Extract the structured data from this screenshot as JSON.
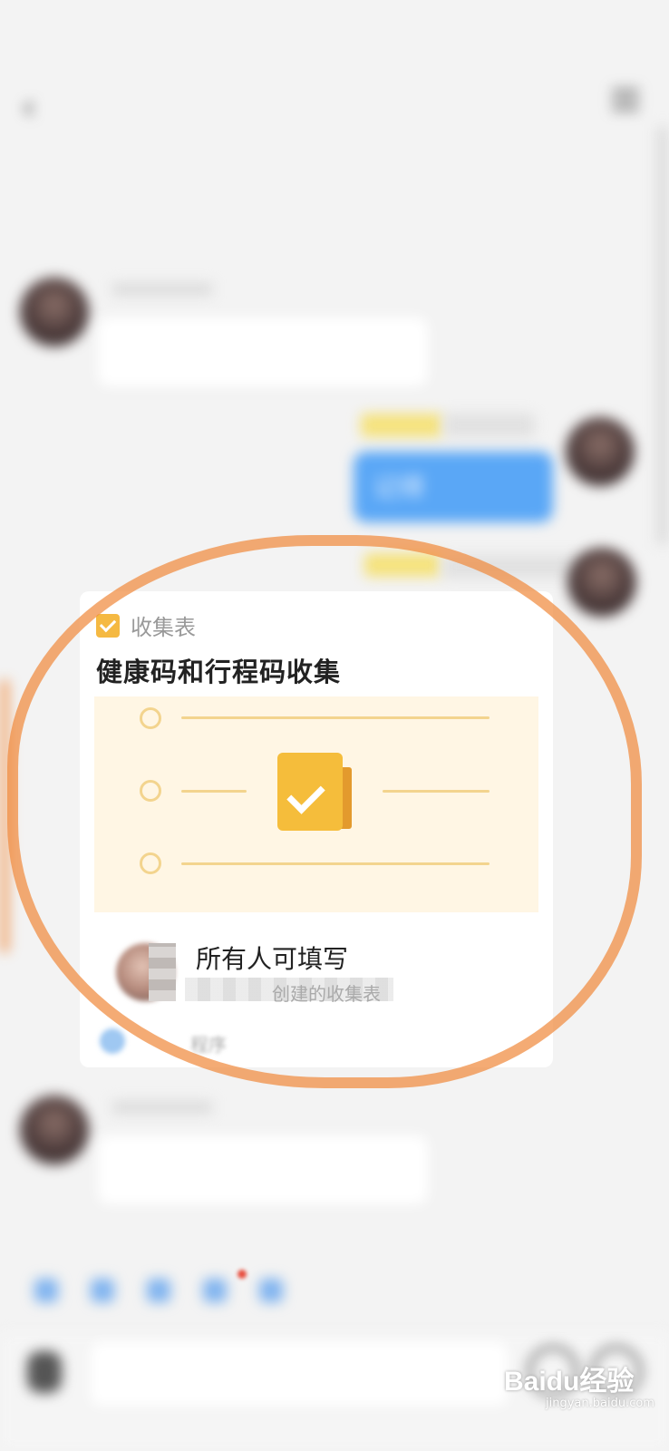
{
  "status_bar": {
    "time": "",
    "battery": ""
  },
  "header": {
    "title": "",
    "subtitle": ""
  },
  "chat": {
    "system_message": "",
    "timestamp": "",
    "messages": [
      {
        "side": "left",
        "text": ""
      },
      {
        "side": "right",
        "text": "记得"
      },
      {
        "side": "left",
        "text": ""
      }
    ]
  },
  "card": {
    "type_label": "收集表",
    "title": "健康码和行程码收集",
    "permission": "所有人可填写",
    "creator_text": "创建的收集表",
    "source": "程序"
  },
  "quick_bar": [
    {
      "label": "",
      "icon": "quick-icon-1"
    },
    {
      "label": "",
      "icon": "quick-icon-2"
    },
    {
      "label": "",
      "icon": "quick-icon-3"
    },
    {
      "label": "",
      "icon": "quick-icon-4"
    },
    {
      "label": "",
      "icon": "quick-icon-5"
    }
  ],
  "watermark": {
    "brand": "Baidu经验",
    "url": "jingyan.baidu.com"
  },
  "colors": {
    "highlight": "#f08a3e",
    "accent_yellow": "#f5bd3b",
    "bubble_blue": "#5aa7f6",
    "card_bg": "#fff6e4"
  }
}
